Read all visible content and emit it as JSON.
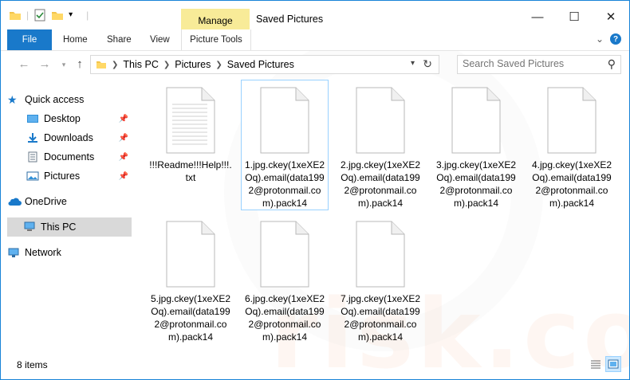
{
  "window": {
    "title": "Saved Pictures",
    "contextual_tab": "Manage",
    "controls": {
      "minimize": "—",
      "maximize": "☐",
      "close": "✕"
    }
  },
  "ribbon": {
    "tabs": [
      "File",
      "Home",
      "Share",
      "View",
      "Picture Tools"
    ]
  },
  "address": {
    "crumbs": [
      "This PC",
      "Pictures",
      "Saved Pictures"
    ]
  },
  "search": {
    "placeholder": "Search Saved Pictures"
  },
  "nav": {
    "quick_access": "Quick access",
    "items": [
      {
        "label": "Desktop",
        "icon": "desktop-icon"
      },
      {
        "label": "Downloads",
        "icon": "downloads-icon"
      },
      {
        "label": "Documents",
        "icon": "documents-icon"
      },
      {
        "label": "Pictures",
        "icon": "pictures-icon"
      }
    ],
    "onedrive": "OneDrive",
    "thispc": "This PC",
    "network": "Network"
  },
  "files": [
    {
      "name": "!!!Readme!!!Help!!!.txt",
      "type": "text"
    },
    {
      "name": "1.jpg.ckey(1xeXE2Oq).email(data1992@protonmail.com).pack14",
      "type": "blank"
    },
    {
      "name": "2.jpg.ckey(1xeXE2Oq).email(data1992@protonmail.com).pack14",
      "type": "blank"
    },
    {
      "name": "3.jpg.ckey(1xeXE2Oq).email(data1992@protonmail.com).pack14",
      "type": "blank"
    },
    {
      "name": "4.jpg.ckey(1xeXE2Oq).email(data1992@protonmail.com).pack14",
      "type": "blank"
    },
    {
      "name": "5.jpg.ckey(1xeXE2Oq).email(data1992@protonmail.com).pack14",
      "type": "blank"
    },
    {
      "name": "6.jpg.ckey(1xeXE2Oq).email(data1992@protonmail.com).pack14",
      "type": "blank"
    },
    {
      "name": "7.jpg.ckey(1xeXE2Oq).email(data1992@protonmail.com).pack14",
      "type": "blank"
    }
  ],
  "status": {
    "count": "8 items"
  },
  "colors": {
    "accent": "#1979ca",
    "manage_tab": "#f8eb98",
    "selection": "#cce8ff"
  }
}
